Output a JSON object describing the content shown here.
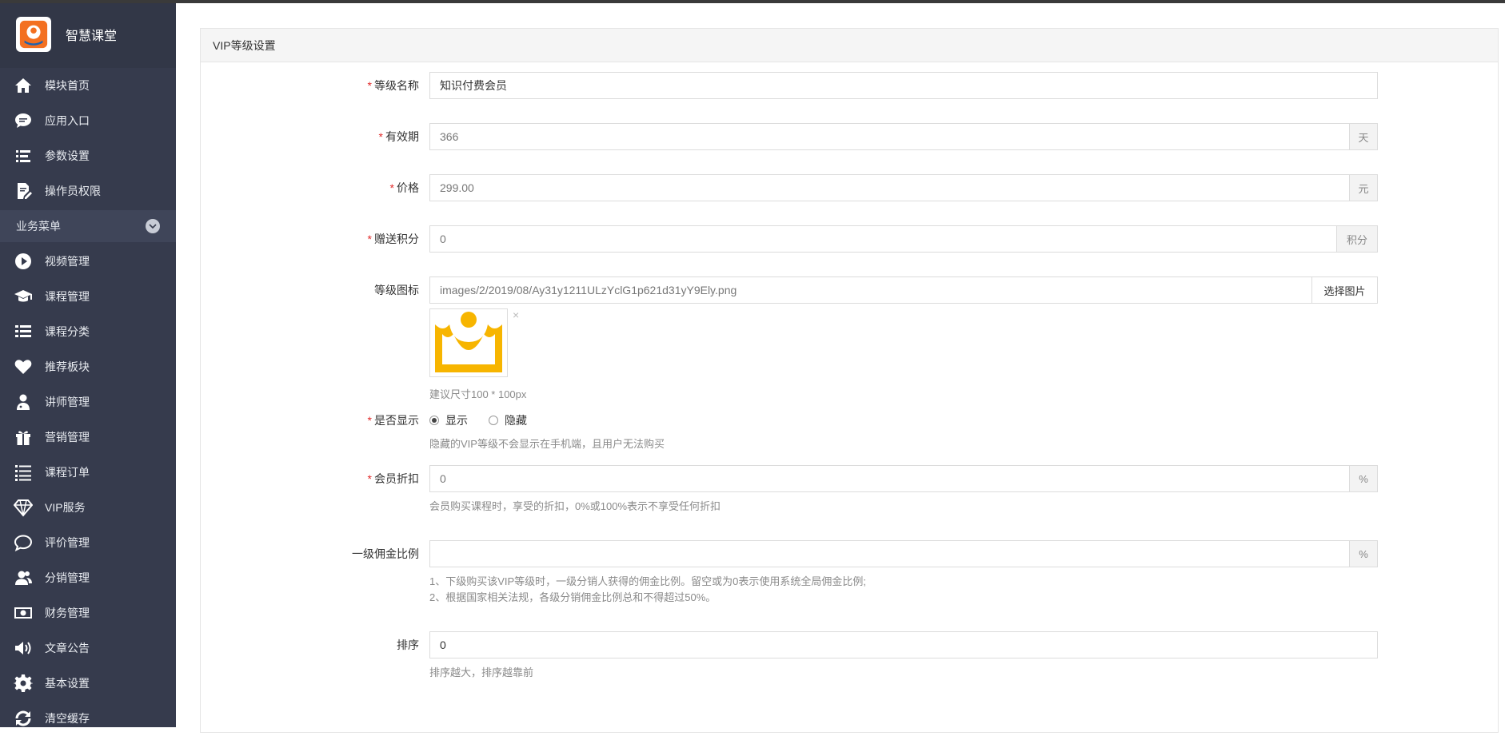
{
  "brand": {
    "name": "智慧课堂",
    "logo_icon": "app-logo-icon"
  },
  "sidebar": {
    "top_items": [
      {
        "label": "模块首页",
        "icon": "home-icon"
      },
      {
        "label": "应用入口",
        "icon": "chat-bubble-icon"
      },
      {
        "label": "参数设置",
        "icon": "list-settings-icon"
      },
      {
        "label": "操作员权限",
        "icon": "document-edit-icon"
      }
    ],
    "section": {
      "label": "业务菜单",
      "icon": "chevron-down-icon"
    },
    "items": [
      {
        "label": "视频管理",
        "icon": "play-circle-icon"
      },
      {
        "label": "课程管理",
        "icon": "graduation-cap-icon"
      },
      {
        "label": "课程分类",
        "icon": "list-icon"
      },
      {
        "label": "推荐板块",
        "icon": "heart-icon"
      },
      {
        "label": "讲师管理",
        "icon": "teacher-icon"
      },
      {
        "label": "营销管理",
        "icon": "gift-icon"
      },
      {
        "label": "课程订单",
        "icon": "ordered-list-icon"
      },
      {
        "label": "VIP服务",
        "icon": "diamond-icon"
      },
      {
        "label": "评价管理",
        "icon": "comment-icon"
      },
      {
        "label": "分销管理",
        "icon": "users-icon"
      },
      {
        "label": "财务管理",
        "icon": "money-icon"
      },
      {
        "label": "文章公告",
        "icon": "volume-icon"
      },
      {
        "label": "基本设置",
        "icon": "gear-icon"
      },
      {
        "label": "清空缓存",
        "icon": "refresh-icon"
      }
    ]
  },
  "panel": {
    "title": "VIP等级设置"
  },
  "form": {
    "level_name": {
      "label": "等级名称",
      "required": "*",
      "value": "知识付费会员"
    },
    "validity": {
      "label": "有效期",
      "required": "*",
      "value": "366",
      "suffix": "天"
    },
    "price": {
      "label": "价格",
      "required": "*",
      "value": "299.00",
      "suffix": "元"
    },
    "points": {
      "label": "赠送积分",
      "required": "*",
      "value": "0",
      "suffix": "积分"
    },
    "icon": {
      "label": "等级图标",
      "value": "images/2/2019/08/Ay31y1211ULzYclG1p621d31yY9Ely.png",
      "button": "选择图片",
      "remove": "×",
      "help": "建议尺寸100 * 100px",
      "image_icon": "crown-icon",
      "image_color": "#f7b500"
    },
    "display": {
      "label": "是否显示",
      "required": "*",
      "options": [
        "显示",
        "隐藏"
      ],
      "selected": "显示",
      "help": "隐藏的VIP等级不会显示在手机端，且用户无法购买"
    },
    "discount": {
      "label": "会员折扣",
      "required": "*",
      "value": "0",
      "suffix": "%",
      "help": "会员购买课程时，享受的折扣，0%或100%表示不享受任何折扣"
    },
    "commission": {
      "label": "一级佣金比例",
      "value": "",
      "suffix": "%",
      "help1": "1、下级购买该VIP等级时，一级分销人获得的佣金比例。留空或为0表示使用系统全局佣金比例;",
      "help2": "2、根据国家相关法规，各级分销佣金比例总和不得超过50%。"
    },
    "sort": {
      "label": "排序",
      "value": "0",
      "help": "排序越大，排序越靠前"
    }
  },
  "colors": {
    "sidebar_bg": "#363b4d",
    "required": "#e12b2b",
    "crown": "#f7b500"
  }
}
